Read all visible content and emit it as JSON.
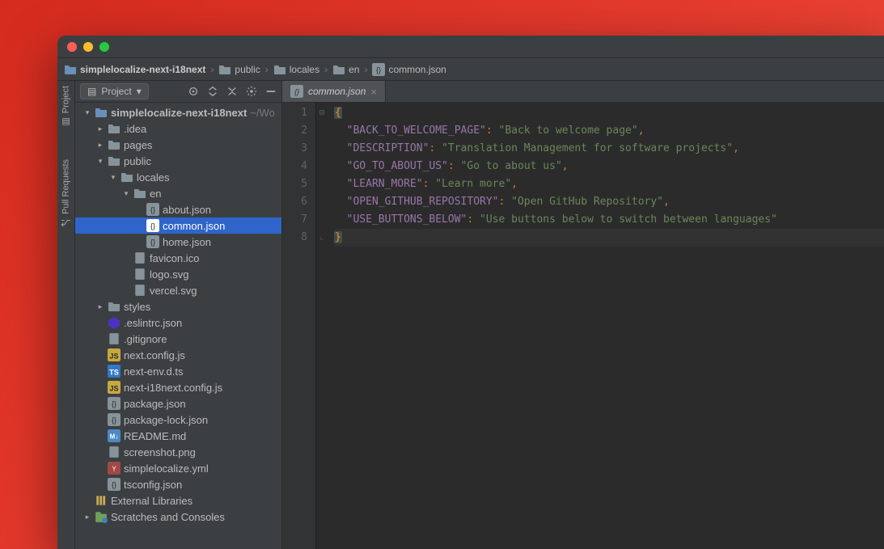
{
  "breadcrumb": {
    "root": "simplelocalize-next-i18next",
    "items": [
      "public",
      "locales",
      "en",
      "common.json"
    ]
  },
  "sidebarVertical": {
    "project": "Project",
    "pullRequests": "Pull Requests"
  },
  "panel": {
    "title": "Project",
    "dropdownGlyph": "▾"
  },
  "tree": {
    "root": {
      "name": "simplelocalize-next-i18next",
      "hint": "~/Wo"
    },
    "items": [
      {
        "depth": 1,
        "arrow": "right",
        "icon": "folder",
        "label": ".idea"
      },
      {
        "depth": 1,
        "arrow": "right",
        "icon": "folder",
        "label": "pages"
      },
      {
        "depth": 1,
        "arrow": "down",
        "icon": "folder",
        "label": "public"
      },
      {
        "depth": 2,
        "arrow": "down",
        "icon": "folder",
        "label": "locales"
      },
      {
        "depth": 3,
        "arrow": "down",
        "icon": "folder",
        "label": "en"
      },
      {
        "depth": 4,
        "arrow": "",
        "icon": "json",
        "label": "about.json"
      },
      {
        "depth": 4,
        "arrow": "",
        "icon": "json",
        "label": "common.json",
        "selected": true
      },
      {
        "depth": 4,
        "arrow": "",
        "icon": "json",
        "label": "home.json"
      },
      {
        "depth": 3,
        "arrow": "",
        "icon": "file",
        "label": "favicon.ico"
      },
      {
        "depth": 3,
        "arrow": "",
        "icon": "file",
        "label": "logo.svg"
      },
      {
        "depth": 3,
        "arrow": "",
        "icon": "file",
        "label": "vercel.svg"
      },
      {
        "depth": 1,
        "arrow": "right",
        "icon": "folder",
        "label": "styles"
      },
      {
        "depth": 1,
        "arrow": "",
        "icon": "eslint",
        "label": ".eslintrc.json"
      },
      {
        "depth": 1,
        "arrow": "",
        "icon": "file",
        "label": ".gitignore"
      },
      {
        "depth": 1,
        "arrow": "",
        "icon": "js",
        "label": "next.config.js"
      },
      {
        "depth": 1,
        "arrow": "",
        "icon": "ts",
        "label": "next-env.d.ts"
      },
      {
        "depth": 1,
        "arrow": "",
        "icon": "js",
        "label": "next-i18next.config.js"
      },
      {
        "depth": 1,
        "arrow": "",
        "icon": "json",
        "label": "package.json"
      },
      {
        "depth": 1,
        "arrow": "",
        "icon": "json",
        "label": "package-lock.json"
      },
      {
        "depth": 1,
        "arrow": "",
        "icon": "md",
        "label": "README.md"
      },
      {
        "depth": 1,
        "arrow": "",
        "icon": "file",
        "label": "screenshot.png"
      },
      {
        "depth": 1,
        "arrow": "",
        "icon": "yml",
        "label": "simplelocalize.yml"
      },
      {
        "depth": 1,
        "arrow": "",
        "icon": "json",
        "label": "tsconfig.json"
      }
    ],
    "external": "External Libraries",
    "scratches": "Scratches and Consoles"
  },
  "tab": {
    "label": "common.json"
  },
  "editor": {
    "lineCount": 8,
    "lines": [
      {
        "n": 1,
        "type": "open"
      },
      {
        "n": 2,
        "type": "kv",
        "key": "BACK_TO_WELCOME_PAGE",
        "val": "Back to welcome page",
        "comma": true
      },
      {
        "n": 3,
        "type": "kv",
        "key": "DESCRIPTION",
        "val": "Translation Management for software projects",
        "comma": true
      },
      {
        "n": 4,
        "type": "kv",
        "key": "GO_TO_ABOUT_US",
        "val": "Go to about us",
        "comma": true
      },
      {
        "n": 5,
        "type": "kv",
        "key": "LEARN_MORE",
        "val": "Learn more",
        "comma": true
      },
      {
        "n": 6,
        "type": "kv",
        "key": "OPEN_GITHUB_REPOSITORY",
        "val": "Open GitHub Repository",
        "comma": true
      },
      {
        "n": 7,
        "type": "kv",
        "key": "USE_BUTTONS_BELOW",
        "val": "Use buttons below to switch between languages",
        "comma": false
      },
      {
        "n": 8,
        "type": "close"
      }
    ]
  }
}
